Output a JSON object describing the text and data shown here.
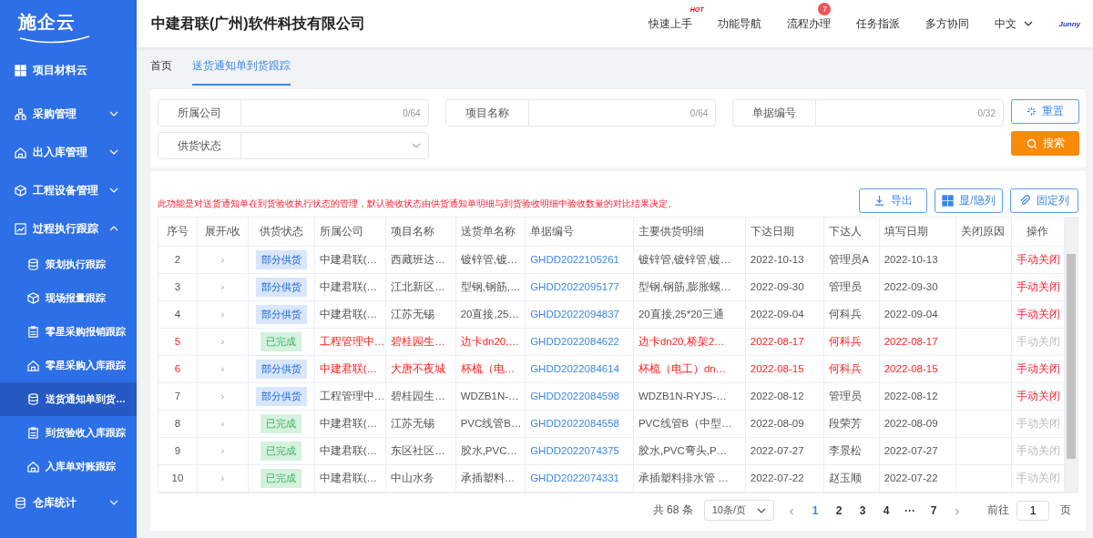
{
  "logo": {
    "text": "施企云"
  },
  "sidebar": {
    "items": [
      {
        "label": "项目材料云",
        "selected": false
      },
      {
        "label": "采购管理",
        "expanded": false,
        "selected": false
      },
      {
        "label": "出入库管理",
        "expanded": false,
        "selected": false
      },
      {
        "label": "工程设备管理",
        "expanded": false,
        "selected": false
      },
      {
        "label": "过程执行跟踪",
        "expanded": true,
        "selected": false,
        "children": [
          {
            "label": "策划执行跟踪",
            "selected": false
          },
          {
            "label": "现场报量跟踪",
            "selected": false
          },
          {
            "label": "零星采购报销跟踪",
            "selected": false
          },
          {
            "label": "零星采购入库跟踪",
            "selected": false
          },
          {
            "label": "送货通知单到货…",
            "selected": true
          },
          {
            "label": "到货验收入库跟踪",
            "selected": false
          },
          {
            "label": "入库单对账跟踪",
            "selected": false
          }
        ]
      },
      {
        "label": "仓库统计",
        "expanded": false,
        "selected": false
      }
    ]
  },
  "header": {
    "company": "中建君联(广州)软件科技有限公司",
    "brand": "Junny",
    "nav": [
      {
        "label": "快速上手",
        "badge": "HOT",
        "kind": "hot"
      },
      {
        "label": "功能导航",
        "kind": "plain"
      },
      {
        "label": "流程办理",
        "badge": "7",
        "kind": "count"
      },
      {
        "label": "任务指派",
        "kind": "plain"
      },
      {
        "label": "多方协同",
        "kind": "plain"
      }
    ],
    "language": "中文"
  },
  "tabs": [
    {
      "label": "首页",
      "selected": false
    },
    {
      "label": "送货通知单到货跟踪",
      "selected": true
    }
  ],
  "filters": [
    {
      "label": "所属公司",
      "kind": "text",
      "counter": "0/64"
    },
    {
      "label": "项目名称",
      "kind": "text",
      "counter": "0/64"
    },
    {
      "label": "单据编号",
      "kind": "text",
      "counter": "0/32"
    },
    {
      "label": "供货状态",
      "kind": "select"
    }
  ],
  "filter_buttons": {
    "reset": "重置",
    "search": "搜索"
  },
  "notice": "此功能是对送货通知单在到货验收执行状态的管理，默认验收状态由供货通知单明细与到货验收明细中验收数量的对比结果决定。",
  "toolbar": [
    "导出",
    "显/隐列",
    "固定列"
  ],
  "table": {
    "columns": [
      "序号",
      "展开/收",
      "供货状态",
      "所属公司",
      "项目名称",
      "送货单名称",
      "单据编号",
      "主要供货明细",
      "下达日期",
      "下达人",
      "填写日期",
      "关闭原因",
      "操作"
    ],
    "rows": [
      {
        "no": "2",
        "expand": "›",
        "status": {
          "label": "部分供货",
          "color": "#d9e6fb"
        },
        "company": "中建君联(…",
        "project": "西藏班达…",
        "delivery": "镀锌管,镀…",
        "code": "GHDD2022105261",
        "detail": "镀锌管,镀锌管,镀…",
        "issued": "2022-10-13",
        "issuer": "管理员A",
        "filled": "2022-10-13",
        "action": "手动关闭",
        "action_disabled": false,
        "warning": false
      },
      {
        "no": "3",
        "expand": "›",
        "status": {
          "label": "部分供货",
          "color": "#d9e6fb"
        },
        "company": "中建君联(…",
        "project": "江北新区…",
        "delivery": "型钢,钢筋,…",
        "code": "GHDD2022095177",
        "detail": "型钢,钢筋,膨胀螺…",
        "issued": "2022-09-30",
        "issuer": "管理员",
        "filled": "2022-09-30",
        "action": "手动关闭",
        "action_disabled": false,
        "warning": false
      },
      {
        "no": "4",
        "expand": "›",
        "status": {
          "label": "部分供货",
          "color": "#d9e6fb"
        },
        "company": "中建君联(…",
        "project": "江苏无锡",
        "delivery": "20直接,25…",
        "code": "GHDD2022094837",
        "detail": "20直接,25*20三通",
        "issued": "2022-09-04",
        "issuer": "何科兵",
        "filled": "2022-09-04",
        "action": "手动关闭",
        "action_disabled": false,
        "warning": false
      },
      {
        "no": "5",
        "expand": "›",
        "status": {
          "label": "已完成",
          "color": "#d4f2dd"
        },
        "company": "工程管理中…",
        "project": "碧桂园生…",
        "delivery": "边卡dn20,…",
        "code": "GHDD2022084622",
        "detail": "边卡dn20,桥架2…",
        "issued": "2022-08-17",
        "issuer": "何科兵",
        "filled": "2022-08-17",
        "action": "手动关闭",
        "action_disabled": true,
        "warning": true
      },
      {
        "no": "6",
        "expand": "›",
        "status": {
          "label": "部分供货",
          "color": "#d9e6fb"
        },
        "company": "中建君联(…",
        "project": "大唐不夜城",
        "delivery": "杯梳（电…",
        "code": "GHDD2022084614",
        "detail": "杯梳（电工）dn…",
        "issued": "2022-08-15",
        "issuer": "何科兵",
        "filled": "2022-08-15",
        "action": "手动关闭",
        "action_disabled": false,
        "warning": true
      },
      {
        "no": "7",
        "expand": "›",
        "status": {
          "label": "部分供货",
          "color": "#d9e6fb"
        },
        "company": "工程管理中…",
        "project": "碧桂园生…",
        "delivery": "WDZB1N-…",
        "code": "GHDD2022084598",
        "detail": "WDZB1N-RYJS-…",
        "issued": "2022-08-12",
        "issuer": "管理员",
        "filled": "2022-08-12",
        "action": "手动关闭",
        "action_disabled": false,
        "warning": false
      },
      {
        "no": "8",
        "expand": "›",
        "status": {
          "label": "已完成",
          "color": "#d4f2dd"
        },
        "company": "中建君联(…",
        "project": "江苏无锡",
        "delivery": "PVC线管B…",
        "code": "GHDD2022084558",
        "detail": "PVC线管B（中型…",
        "issued": "2022-08-09",
        "issuer": "段荣芳",
        "filled": "2022-08-09",
        "action": "手动关闭",
        "action_disabled": true,
        "warning": false
      },
      {
        "no": "9",
        "expand": "›",
        "status": {
          "label": "已完成",
          "color": "#d4f2dd"
        },
        "company": "中建君联(…",
        "project": "东区社区…",
        "delivery": "胶水,PVC…",
        "code": "GHDD2022074375",
        "detail": "胶水,PVC弯头,P…",
        "issued": "2022-07-27",
        "issuer": "李景松",
        "filled": "2022-07-27",
        "action": "手动关闭",
        "action_disabled": true,
        "warning": false
      },
      {
        "no": "10",
        "expand": "›",
        "status": {
          "label": "已完成",
          "color": "#d4f2dd"
        },
        "company": "中建君联(…",
        "project": "中山水务",
        "delivery": "承插塑料…",
        "code": "GHDD2022074331",
        "detail": "承插塑料排水管 …",
        "issued": "2022-07-22",
        "issuer": "赵玉顺",
        "filled": "2022-07-22",
        "action": "手动关闭",
        "action_disabled": true,
        "warning": false
      }
    ]
  },
  "pagination": {
    "total": "共 68 条",
    "page_size": "10条/页",
    "prev": "‹",
    "next": "›",
    "pages": [
      {
        "label": "1",
        "selected": true
      },
      {
        "label": "2",
        "selected": false
      },
      {
        "label": "3",
        "selected": false
      },
      {
        "label": "4",
        "selected": false
      },
      {
        "label": "···",
        "selected": false
      },
      {
        "label": "7",
        "selected": false
      }
    ],
    "goto_label": "前往",
    "goto_value": "1",
    "goto_suffix": "页"
  }
}
